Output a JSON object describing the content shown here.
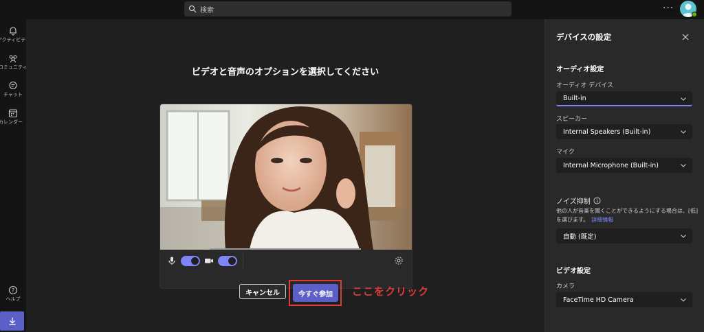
{
  "topbar": {
    "search_placeholder": "検索",
    "more": "···"
  },
  "rail": {
    "items": [
      {
        "label": "アクティビティ",
        "icon": "bell-icon"
      },
      {
        "label": "コミュニティ",
        "icon": "people-icon"
      },
      {
        "label": "チャット",
        "icon": "chat-icon"
      },
      {
        "label": "カレンダー",
        "icon": "calendar-icon"
      }
    ],
    "help_label": "ヘルプ"
  },
  "main": {
    "title": "ビデオと音声のオプションを選択してください",
    "mic_on": true,
    "camera_on": true,
    "cancel_label": "キャンセル",
    "join_label": "今すぐ参加",
    "annotation": "ここをクリック"
  },
  "panel": {
    "title": "デバイスの設定",
    "audio_section": "オーディオ設定",
    "audio_device_label": "オーディオ デバイス",
    "audio_device_value": "Built-in",
    "speaker_label": "スピーカー",
    "speaker_value": "Internal Speakers (Built-in)",
    "mic_label": "マイク",
    "mic_value": "Internal Microphone (Built-in)",
    "noise_label": "ノイズ抑制",
    "noise_desc": "他の人が音楽を聞くことができるようにする場合は、[低] を選びます。",
    "noise_link": "詳細情報",
    "noise_value": "自動 (既定)",
    "video_section": "ビデオ設定",
    "camera_label": "カメラ",
    "camera_value": "FaceTime HD Camera"
  },
  "colors": {
    "accent": "#5b5fc7",
    "toggle": "#7f85f5",
    "annotation": "#e03a3a"
  }
}
